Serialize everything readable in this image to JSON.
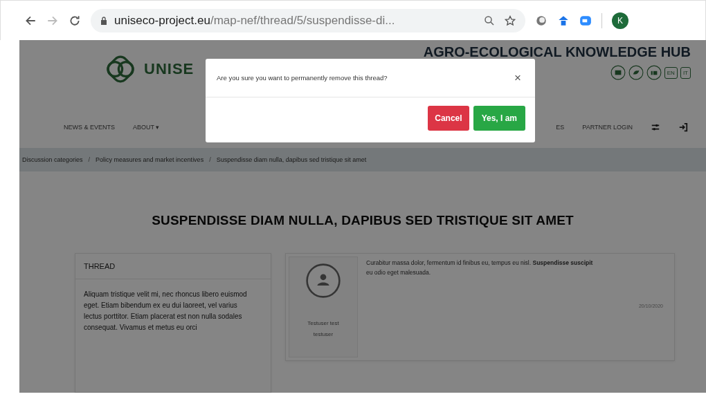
{
  "browser": {
    "url_domain": "uniseco-project.eu",
    "url_path": "/map-nef/thread/5/suspendisse-di...",
    "profile": "K"
  },
  "header": {
    "logo": "UNISE",
    "hub_title": "AGRO-ECOLOGICAL KNOWLEDGE HUB",
    "languages": [
      "EN",
      "IT"
    ]
  },
  "nav": {
    "left": [
      "NEWS & EVENTS",
      "ABOUT ▾"
    ],
    "right": [
      "ES",
      "PARTNER LOGIN"
    ]
  },
  "breadcrumb_separator": "/",
  "breadcrumb": [
    "Discussion categories",
    "Policy measures and market incentives",
    "Suspendisse diam nulla, dapibus sed tristique sit amet"
  ],
  "page_title": "SUSPENDISSE DIAM NULLA, DAPIBUS SED TRISTIQUE SIT AMET",
  "thread": {
    "heading": "THREAD",
    "text": "Aliquam tristique velit mi, nec rhoncus libero euismod eget. Etiam bibendum ex eu dui laoreet, vel varius lectus porttitor. Etiam placerat est non nulla sodales consequat. Vivamus et metus eu orci"
  },
  "post": {
    "author": "Testuser test testuser",
    "text": "Curabitur massa dolor, fermentum id finibus eu, tempus eu nisl. **Suspendisse suscipit** eu odio eget malesuada.",
    "date": "20/10/2020"
  },
  "dialog": {
    "message": "Are you sure you want to permanently remove this thread?",
    "close": "×",
    "buttons": [
      {
        "label": "Cancel",
        "kind": "danger"
      },
      {
        "label": "Yes, I am",
        "kind": "confirm"
      }
    ]
  }
}
